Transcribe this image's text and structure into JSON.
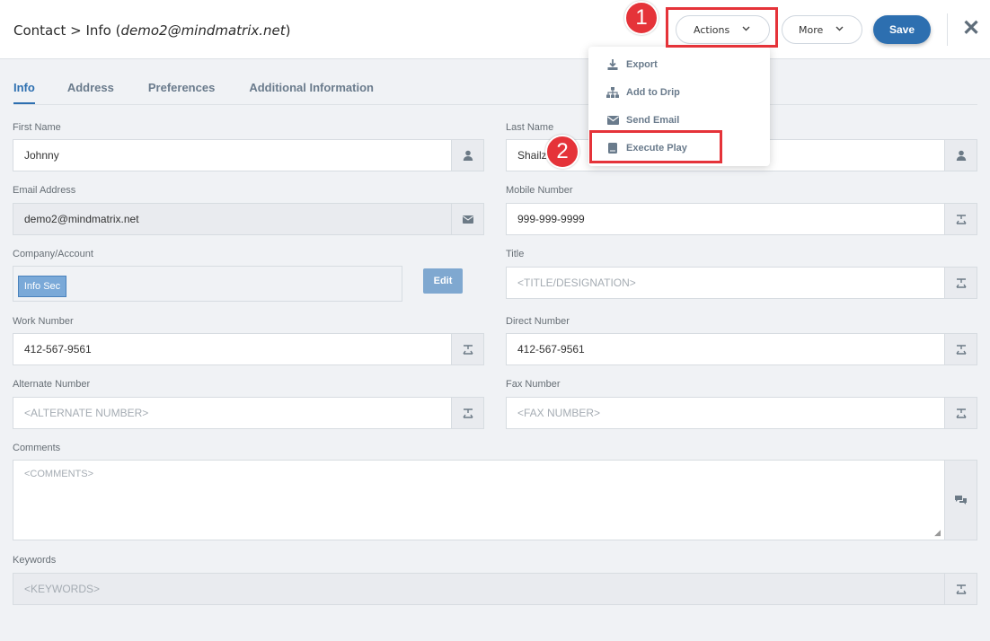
{
  "header": {
    "title_prefix": "Contact > Info (",
    "title_email": "demo2@mindmatrix.net",
    "title_suffix": ")",
    "actions_label": "Actions",
    "more_label": "More",
    "save_label": "Save",
    "close_label": "✕"
  },
  "callouts": {
    "one": "1",
    "two": "2"
  },
  "dropdown": {
    "items": [
      {
        "label": "Export",
        "icon": "download-icon"
      },
      {
        "label": "Add to Drip",
        "icon": "sitemap-icon"
      },
      {
        "label": "Send Email",
        "icon": "envelope-icon"
      },
      {
        "label": "Execute Play",
        "icon": "book-icon"
      }
    ]
  },
  "tabs": [
    {
      "label": "Info",
      "active": true
    },
    {
      "label": "Address"
    },
    {
      "label": "Preferences"
    },
    {
      "label": "Additional Information"
    }
  ],
  "form": {
    "first_name": {
      "label": "First Name",
      "value": "Johnny"
    },
    "last_name": {
      "label": "Last Name",
      "value": "Shailz"
    },
    "email": {
      "label": "Email Address",
      "value": "demo2@mindmatrix.net"
    },
    "mobile": {
      "label": "Mobile Number",
      "value": "999-999-9999"
    },
    "company": {
      "label": "Company/Account",
      "tag": "Info Sec",
      "edit_label": "Edit"
    },
    "title": {
      "label": "Title",
      "placeholder": "<TITLE/DESIGNATION>"
    },
    "work": {
      "label": "Work Number",
      "value": "412-567-9561"
    },
    "direct": {
      "label": "Direct Number",
      "value": "412-567-9561"
    },
    "alternate": {
      "label": "Alternate Number",
      "placeholder": "<ALTERNATE NUMBER>"
    },
    "fax": {
      "label": "Fax Number",
      "placeholder": "<FAX NUMBER>"
    },
    "comments": {
      "label": "Comments",
      "placeholder": "<COMMENTS>"
    },
    "keywords": {
      "label": "Keywords",
      "placeholder": "<KEYWORDS>"
    }
  },
  "colors": {
    "accent": "#2d6fb0",
    "callout": "#e53339"
  }
}
